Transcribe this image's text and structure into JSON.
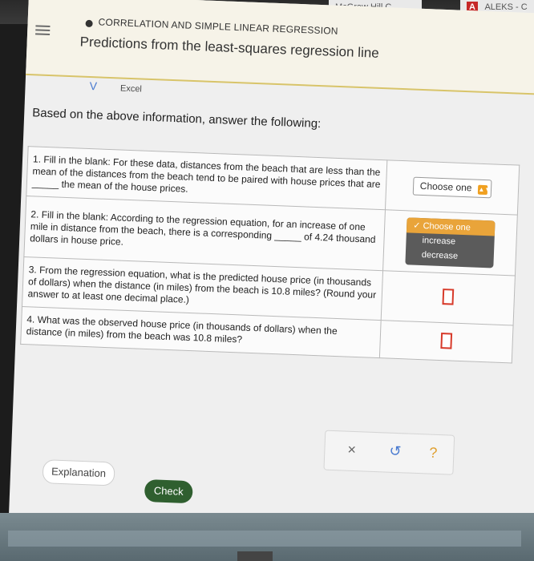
{
  "browser": {
    "tabs": [
      {
        "label": "McGraw Hill C..."
      },
      {
        "label": "ALEKS - C"
      }
    ]
  },
  "header": {
    "topic": "CORRELATION AND SIMPLE LINEAR REGRESSION",
    "title": "Predictions from the least-squares regression line"
  },
  "excel": {
    "chevron": "V",
    "label": "Excel"
  },
  "prompt": "Based on the above information, answer the following:",
  "questions": [
    {
      "text": "1. Fill in the blank: For these data, distances from the beach that are less than the mean of the distances from the beach tend to be paired with house prices that are _____ the mean of the house prices.",
      "answer": {
        "type": "select",
        "label": "Choose one"
      }
    },
    {
      "text": "2. Fill in the blank: According to the regression equation, for an increase of one mile in distance from the beach, there is a corresponding _____ of 4.24 thousand dollars in house price.",
      "answer": {
        "type": "dropdown",
        "selected": "Choose one",
        "options": [
          "increase",
          "decrease"
        ]
      }
    },
    {
      "text": "3. From the regression equation, what is the predicted house price (in thousands of dollars) when the distance (in miles) from the beach is 10.8 miles? (Round your answer to at least one decimal place.)",
      "answer": {
        "type": "input"
      }
    },
    {
      "text": "4. What was the observed house price (in thousands of dollars) when the distance (in miles) from the beach was 10.8 miles?",
      "answer": {
        "type": "input"
      }
    }
  ],
  "toolbar": {
    "close": "×",
    "undo": "↺",
    "help": "?"
  },
  "buttons": {
    "explanation": "Explanation",
    "check": "Check"
  },
  "colors": {
    "accent": "#d8c46a",
    "check": "#2f5f2f",
    "dropdown_selected": "#e9a43a",
    "input_border": "#d73a2a"
  }
}
